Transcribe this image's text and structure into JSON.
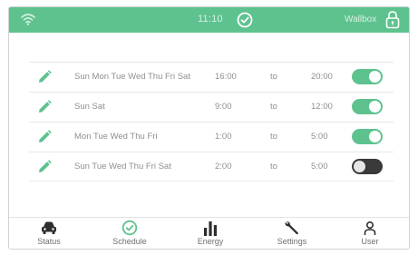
{
  "header": {
    "time": "11:10",
    "device_name": "Wallbox",
    "icons": [
      "wifi-icon",
      "check-circle-icon",
      "lock-icon"
    ],
    "color": "#5ec28f"
  },
  "schedules": [
    {
      "days": "Sun Mon Tue Wed Thu Fri Sat",
      "start": "16:00",
      "to": "to",
      "end": "20:00",
      "enabled": true
    },
    {
      "days": "Sun Sat",
      "start": "9:00",
      "to": "to",
      "end": "12:00",
      "enabled": true
    },
    {
      "days": "Mon Tue Wed Thu Fri",
      "start": "1:00",
      "to": "to",
      "end": "5:00",
      "enabled": true
    },
    {
      "days": "Sun Tue Wed Thu Fri Sat",
      "start": "2:00",
      "to": "to",
      "end": "5:00",
      "enabled": false
    }
  ],
  "nav": {
    "items": [
      {
        "label": "Status",
        "icon": "car-icon"
      },
      {
        "label": "Schedule",
        "icon": "check-circle-icon",
        "active": true
      },
      {
        "label": "Energy",
        "icon": "bar-chart-icon"
      },
      {
        "label": "Settings",
        "icon": "wrench-icon"
      },
      {
        "label": "User",
        "icon": "user-icon"
      }
    ]
  },
  "colors": {
    "accent": "#5ec28f",
    "toggle_off": "#3a3a3a"
  }
}
